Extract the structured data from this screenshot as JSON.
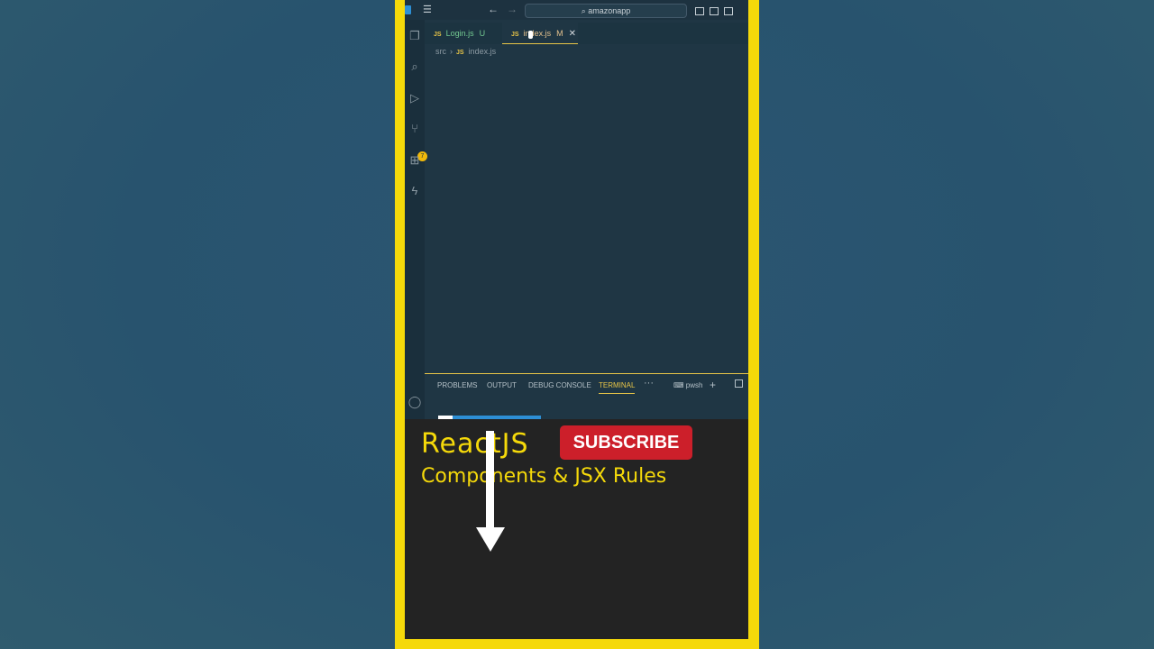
{
  "titlebar": {
    "search_text": "amazonapp"
  },
  "tabs": [
    {
      "label": "Login.js",
      "status": "U",
      "lang": "JS"
    },
    {
      "label": "index.js",
      "status": "M",
      "lang": "JS",
      "close": "✕"
    }
  ],
  "breadcrumb": {
    "folder": "src",
    "file": "index.js",
    "lang": "JS"
  },
  "activity": {
    "badge": "7"
  },
  "panel": {
    "tabs": [
      "PROBLEMS",
      "OUTPUT",
      "DEBUG CONSOLE",
      "TERMINAL"
    ],
    "active_tab": "TERMINAL",
    "more": "···",
    "shell": "pwsh"
  },
  "overlay": {
    "title": "ReactJS",
    "subtitle": "Components & JSX Rules",
    "subscribe": "SUBSCRIBE"
  },
  "colors": {
    "frame": "#f5d90a",
    "accent": "#e8c547",
    "subscribe": "#cc1f2a"
  }
}
